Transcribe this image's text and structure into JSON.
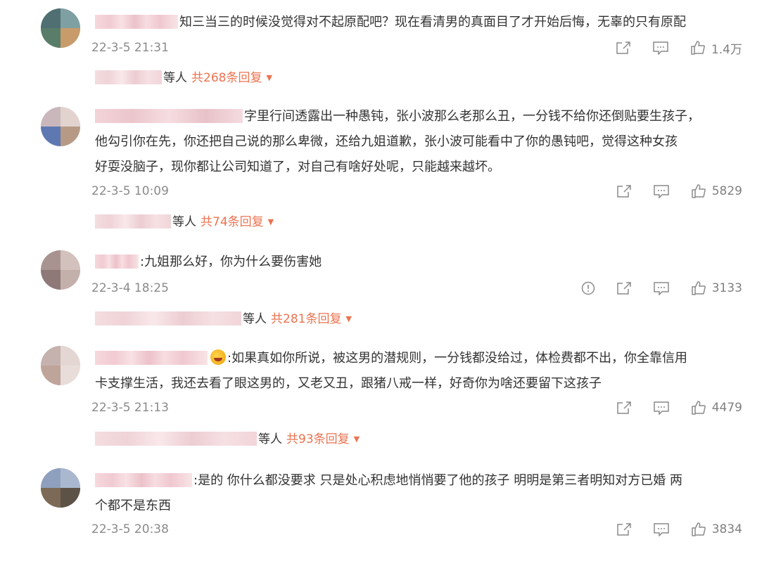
{
  "comments": [
    {
      "text": "知三当三的时候没觉得对不起原配吧？现在看清男的真面目了才开始后悔，无辜的只有原配",
      "time": "22-3-5 21:31",
      "likes": "1.4万",
      "reply_suffix": "等人",
      "reply_count": "共268条回复"
    },
    {
      "line1": "字里行间透露出一种愚钝，张小波那么老那么丑，一分钱不给你还倒贴要生孩子，",
      "line2": "他勾引你在先，你还把自己说的那么卑微，还给九姐道歉，张小波可能看中了你的愚钝吧，觉得这种女孩",
      "line3": "好耍没脑子，现你都让公司知道了，对自己有啥好处呢，只能越来越坏。",
      "time": "22-3-5 10:09",
      "likes": "5829",
      "reply_suffix": "等人",
      "reply_count": "共74条回复"
    },
    {
      "text": ":九姐那么好，你为什么要伤害她",
      "time": "22-3-4 18:25",
      "likes": "3133",
      "reply_suffix": "等人",
      "reply_count": "共281条回复"
    },
    {
      "line1": ":如果真如你所说，被这男的潜规则，一分钱都没给过，体检费都不出，你全靠信用",
      "line2": "卡支撑生活，我还去看了眼这男的，又老又丑，跟猪八戒一样，好奇你为啥还要留下这孩子",
      "time": "22-3-5 21:13",
      "likes": "4479",
      "reply_suffix": "等人",
      "reply_count": "共93条回复"
    },
    {
      "line1": ":是的 你什么都没要求 只是处心积虑地悄悄要了他的孩子 明明是第三者明知对方已婚 两",
      "line2": "个都不是东西",
      "time": "22-3-5 20:38",
      "likes": "3834"
    }
  ],
  "icons": {
    "share": "share-icon",
    "comment": "comment-icon",
    "like": "thumbs-up-icon",
    "report": "report-icon"
  },
  "colors": {
    "accent": "#eb7350",
    "meta": "#8a8a8a"
  }
}
